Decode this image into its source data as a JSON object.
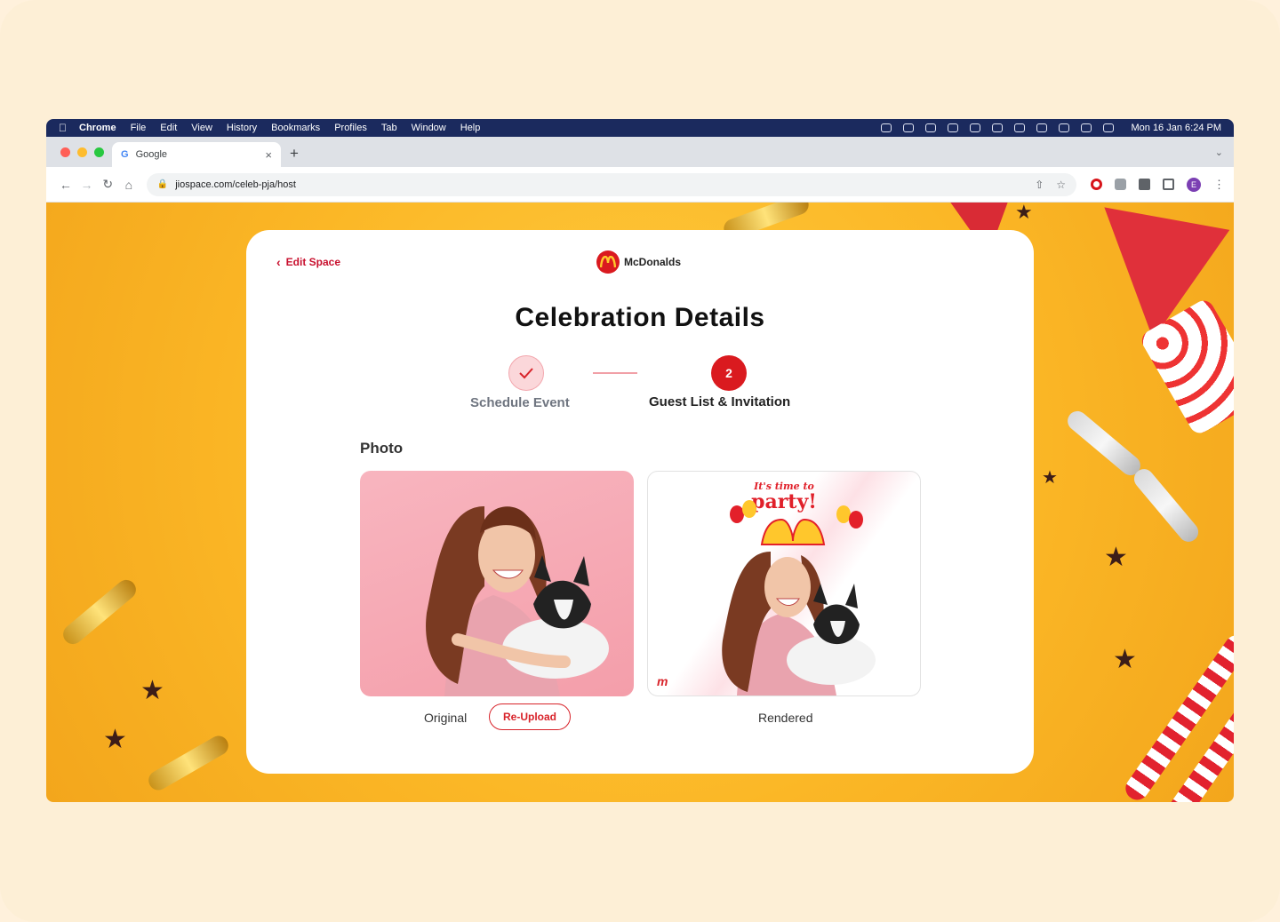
{
  "menubar": {
    "app": "Chrome",
    "items": [
      "File",
      "Edit",
      "View",
      "History",
      "Bookmarks",
      "Profiles",
      "Tab",
      "Window",
      "Help"
    ],
    "clock": "Mon 16 Jan  6:24 PM"
  },
  "browser": {
    "tab_title": "Google",
    "url": "jiospace.com/celeb-pja/host",
    "profile_initial": "E"
  },
  "page": {
    "back_label": "Edit Space",
    "brand_name": "McDonalds",
    "title": "Celebration Details",
    "steps": [
      {
        "label": "Schedule Event",
        "state": "completed"
      },
      {
        "number": "2",
        "label": "Guest List & Invitation",
        "state": "active"
      }
    ],
    "section_label": "Photo",
    "original_caption": "Original",
    "reupload_label": "Re-Upload",
    "rendered_caption": "Rendered",
    "overlay_small": "It's time to",
    "overlay_big": "party!"
  },
  "colors": {
    "accent": "#da1a1f",
    "background": "#fbb726",
    "menubar": "#1b2a5e"
  }
}
